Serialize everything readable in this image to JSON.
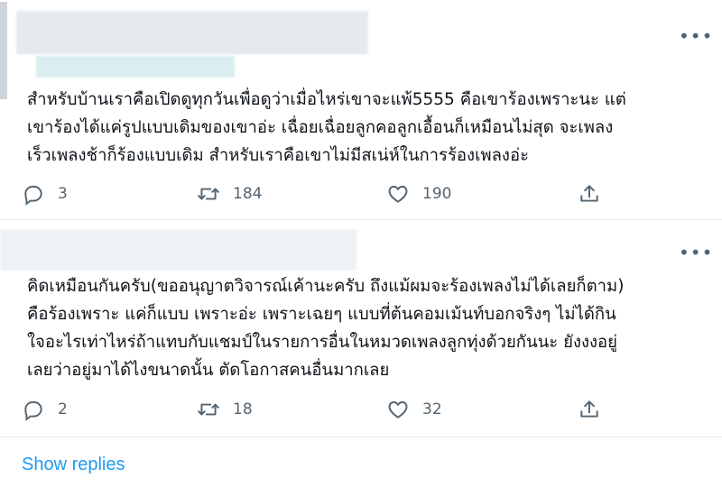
{
  "tweets": [
    {
      "text": "สำหรับบ้านเราคือเปิดดูทุกวันเพื่อดูว่าเมื่อไหร่เขาจะแพ้5555 คือเขาร้องเพราะนะ แต่\nเขาร้องได้แค่รูปแบบเดิมของเขาอ่ะ เฉื่อยเฉื่อยลูกคอลูกเอื้อนก็เหมือนไม่สุด จะเพลง\nเร็วเพลงช้าก็ร้องแบบเดิม สำหรับเราคือเขาไม่มีสเน่ห์ในการร้องเพลงอ่ะ",
      "replies": "3",
      "retweets": "184",
      "likes": "190"
    },
    {
      "text": "คิดเหมือนกันครับ(ขออนุญาตวิจารณ์เค้านะครับ ถึงแม้ผมจะร้องเพลงไม่ได้เลยก็ตาม)\nคือร้องเพราะ แค่ก็แบบ เพราะอ่ะ เพราะเฉยๆ แบบที่ต้นคอมเม้นท์บอกจริงๆ ไม่ได้กิน\nใจอะไรเท่าไหร่ถ้าแทบกับแชมป์ในรายการอื่นในหมวดเพลงลูกทุ่งด้วยกันนะ ยังงงอยู่\nเลยว่าอยู่มาได้ไงขนาดนั้น ตัดโอกาสคนอื่นมากเลย",
      "replies": "2",
      "retweets": "18",
      "likes": "32"
    }
  ],
  "more_label": "•••",
  "show_replies_label": "Show replies",
  "colors": {
    "accent": "#1d9bf0",
    "muted": "#536471",
    "divider": "#e6ecf0"
  },
  "icons": [
    "reply-icon",
    "retweet-icon",
    "like-icon",
    "share-icon",
    "more-icon"
  ]
}
